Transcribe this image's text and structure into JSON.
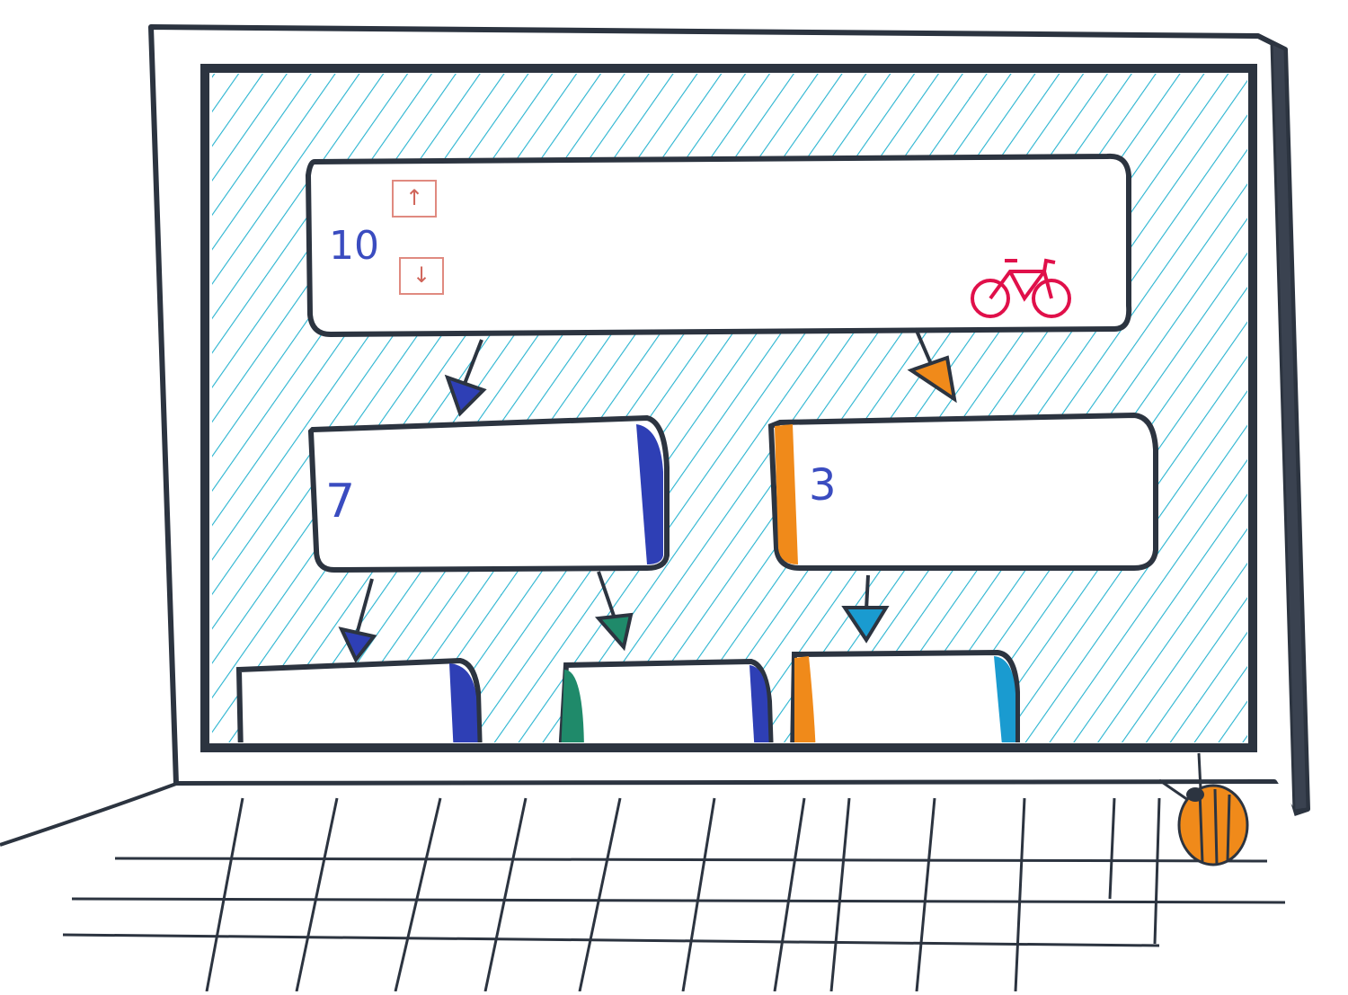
{
  "tree": {
    "root": {
      "value": "10"
    },
    "left_child": {
      "value": "7"
    },
    "right_child": {
      "value": "3"
    }
  },
  "controls": {
    "up_glyph": "↑",
    "down_glyph": "↓"
  },
  "icons": {
    "bike": "bicycle-icon",
    "beetle": "ladybug-beetle-icon"
  },
  "colors": {
    "outline": "#2c3440",
    "hatch": "#28b4d0",
    "number": "#3a4cc0",
    "blue_accent": "#2e3fb5",
    "orange_accent": "#f08a1a",
    "green_accent": "#1f8a6a",
    "cyan_accent": "#1a9bd0",
    "bike": "#e0104a",
    "button_border": "#e08a80"
  }
}
